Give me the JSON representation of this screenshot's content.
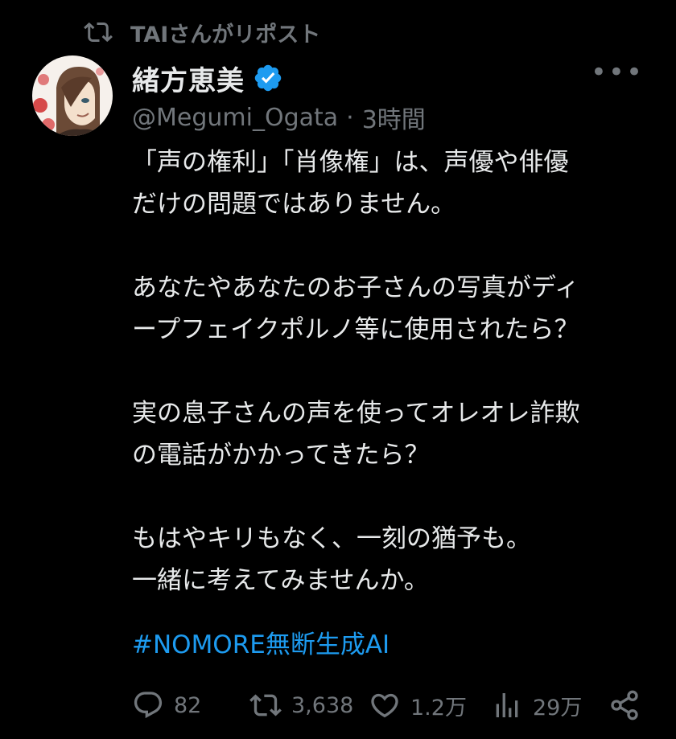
{
  "repost": {
    "label": "TAIさんがリポスト",
    "icon": "repost-icon"
  },
  "tweet": {
    "display_name": "緒方恵美",
    "verified": true,
    "handle": "@Megumi_Ogata",
    "separator": "·",
    "time": "3時間",
    "more_label": "•••",
    "body": "「声の権利」「肖像権」は、声優や俳優\nだけの問題ではありません。\n\nあなたやあなたのお子さんの写真がディ\nープフェイクポルノ等に使用されたら？\n\n実の息子さんの声を使ってオレオレ詐欺\nの電話がかかってきたら？\n\nもはやキリもなく、一刻の猶予も。\n一緒に考えてみませんか。",
    "hashtag": "#NOMORE無断生成AI"
  },
  "actions": {
    "replies": "82",
    "reposts": "3,638",
    "likes": "1.2万",
    "views": "29万"
  },
  "colors": {
    "background": "#000000",
    "text": "#e7e9ea",
    "secondary": "#71767b",
    "accent": "#1d9bf0"
  }
}
